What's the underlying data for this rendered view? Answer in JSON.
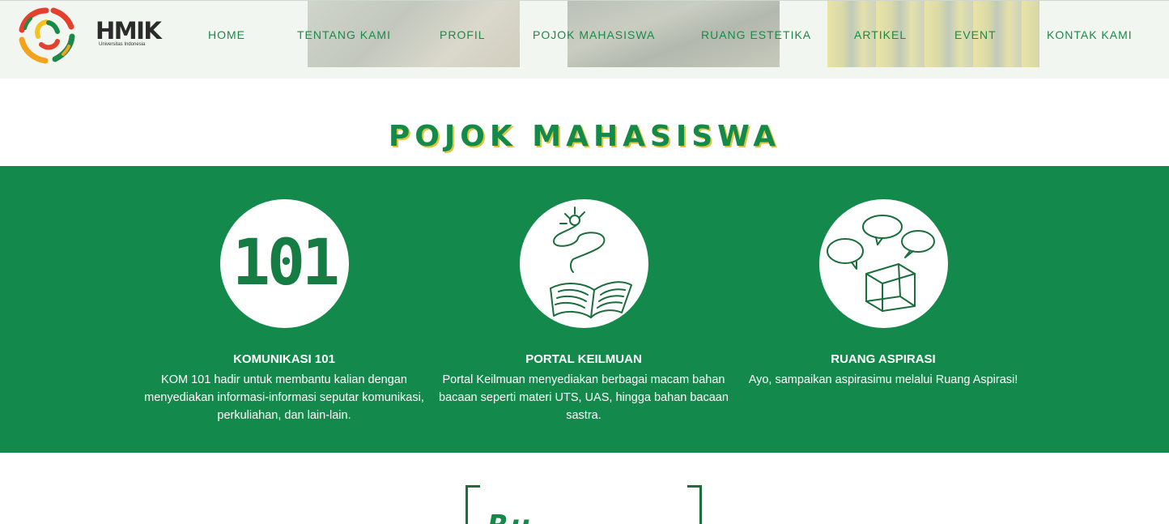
{
  "brand": {
    "name": "HMIK",
    "subtitle": "Universitas Indonesia"
  },
  "nav": [
    {
      "label": "HOME"
    },
    {
      "label": "TENTANG KAMI"
    },
    {
      "label": "PROFIL"
    },
    {
      "label": "POJOK MAHASISWA"
    },
    {
      "label": "RUANG ESTETIKA"
    },
    {
      "label": "ARTIKEL"
    },
    {
      "label": "EVENT"
    },
    {
      "label": "KONTAK KAMI"
    }
  ],
  "section": {
    "title": "POJOK MAHASISWA"
  },
  "cards": [
    {
      "icon_text": "101",
      "title": "KOMUNIKASI 101",
      "description": "KOM 101 hadir untuk membantu kalian dengan menyediakan informasi-informasi seputar komunikasi, perkuliahan, dan lain-lain."
    },
    {
      "icon": "book-lightbulb-icon",
      "title": "PORTAL KEILMUAN",
      "description": "Portal Keilmuan menyediakan berbagai macam bahan bacaan seperti materi UTS, UAS, hingga bahan bacaan sastra."
    },
    {
      "icon": "speech-bubbles-box-icon",
      "title": "RUANG ASPIRASI",
      "description": "Ayo, sampaikan aspirasimu melalui Ruang Aspirasi!"
    }
  ],
  "next_section": {
    "title_partial": "Ru"
  },
  "colors": {
    "green": "#138a4b",
    "text_green": "#1a8a46",
    "accent_yellow": "#e2c43c"
  }
}
